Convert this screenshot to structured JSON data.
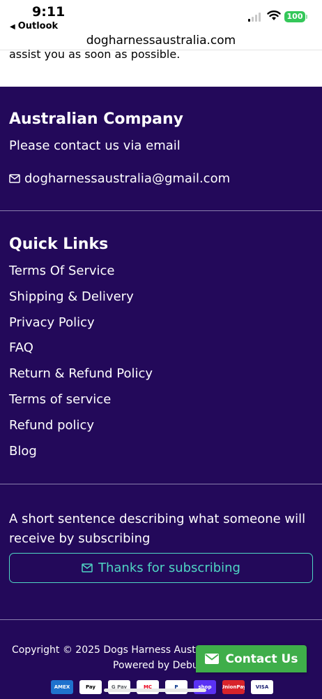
{
  "status_bar": {
    "time": "9:11",
    "back_app": "Outlook",
    "battery": "100"
  },
  "browser": {
    "url": "dogharnessaustralia.com"
  },
  "top_text": "assist you as soon as possible.",
  "company": {
    "heading": "Australian Company",
    "subtext": "Please contact us via email",
    "email": "dogharnessaustralia@gmail.com"
  },
  "quick_links": {
    "heading": "Quick Links",
    "items": [
      "Terms Of Service",
      "Shipping & Delivery",
      "Privacy Policy",
      "FAQ",
      "Return & Refund Policy",
      "Terms of service",
      "Refund policy",
      "Blog"
    ]
  },
  "newsletter": {
    "description": "A short sentence describing what someone will receive by subscribing",
    "button_label": "Thanks for subscribing"
  },
  "footer": {
    "copyright": "Copyright © 2025 Dogs Harness Austral",
    "copyright_end": "l",
    "powered": "Powered by Debu"
  },
  "contact_button": {
    "label": "Contact Us"
  },
  "payments": [
    {
      "name": "American Express",
      "label": "AMEX",
      "bg": "#1f72cd",
      "fg": "#ffffff"
    },
    {
      "name": "Apple Pay",
      "label": "Pay",
      "bg": "#ffffff",
      "fg": "#000000"
    },
    {
      "name": "Google Pay",
      "label": "G Pay",
      "bg": "#ffffff",
      "fg": "#5f6368"
    },
    {
      "name": "Mastercard",
      "label": "MC",
      "bg": "#ffffff",
      "fg": "#eb001b"
    },
    {
      "name": "PayPal",
      "label": "P",
      "bg": "#ffffff",
      "fg": "#003087"
    },
    {
      "name": "Shop Pay",
      "label": "shop",
      "bg": "#5a31f4",
      "fg": "#ffffff"
    },
    {
      "name": "Union Pay",
      "label": "UnionPay",
      "bg": "#d8232a",
      "fg": "#ffffff"
    },
    {
      "name": "Visa",
      "label": "VISA",
      "bg": "#ffffff",
      "fg": "#1a1f71"
    }
  ],
  "colors": {
    "footer_bg": "#23095a",
    "accent": "#4fd6c4",
    "contact_green": "#3fae4a"
  }
}
